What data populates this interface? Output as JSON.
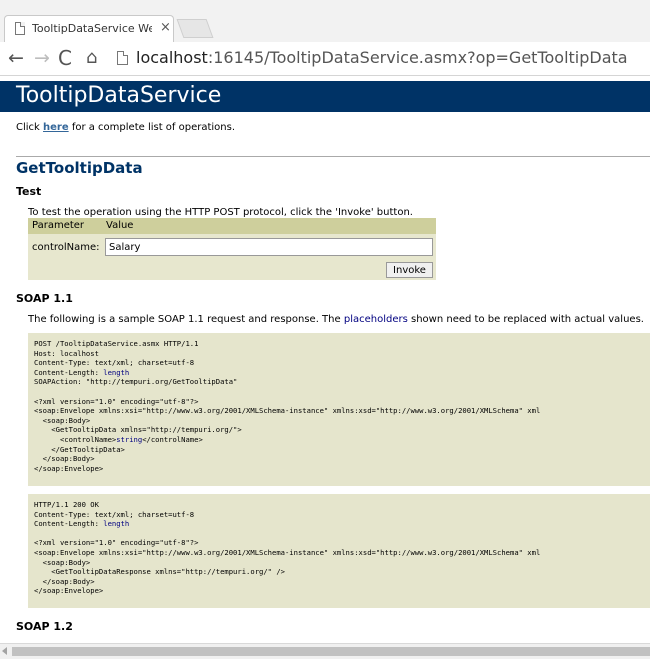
{
  "browser": {
    "tab_title": "TooltipDataService Web S",
    "close_glyph": "×",
    "url_host": "localhost",
    "url_rest": ":16145/TooltipDataService.asmx?op=GetTooltipData"
  },
  "page": {
    "header": "TooltipDataService",
    "intro_pre": "Click ",
    "intro_link": "here",
    "intro_post": " for a complete list of operations.",
    "operation": "GetTooltipData",
    "test_heading": "Test",
    "test_intro": "To test the operation using the HTTP POST protocol, click the 'Invoke' button.",
    "col_parameter": "Parameter",
    "col_value": "Value",
    "param_label": "controlName:",
    "param_value": "Salary",
    "invoke_label": "Invoke",
    "soap11_heading": "SOAP 1.1",
    "soap11_intro_pre": "The following is a sample SOAP 1.1 request and response.  The ",
    "soap11_intro_hl": "placeholders",
    "soap11_intro_post": " shown need to be replaced with actual values.",
    "soap12_heading": "SOAP 1.2"
  },
  "request": {
    "l1": "POST /TooltipDataService.asmx HTTP/1.1",
    "l2": "Host: localhost",
    "l3": "Content-Type: text/xml; charset=utf-8",
    "l4a": "Content-Length: ",
    "l4b": "length",
    "l5": "SOAPAction: \"http://tempuri.org/GetTooltipData\"",
    "l6": "<?xml version=\"1.0\" encoding=\"utf-8\"?>",
    "l7": "<soap:Envelope xmlns:xsi=\"http://www.w3.org/2001/XMLSchema-instance\" xmlns:xsd=\"http://www.w3.org/2001/XMLSchema\" xml",
    "l8": "  <soap:Body>",
    "l9": "    <GetTooltipData xmlns=\"http://tempuri.org/\">",
    "l10a": "      <controlName>",
    "l10b": "string",
    "l10c": "</controlName>",
    "l11": "    </GetTooltipData>",
    "l12": "  </soap:Body>",
    "l13": "</soap:Envelope>"
  },
  "response": {
    "l1": "HTTP/1.1 200 OK",
    "l2": "Content-Type: text/xml; charset=utf-8",
    "l3a": "Content-Length: ",
    "l3b": "length",
    "l4": "<?xml version=\"1.0\" encoding=\"utf-8\"?>",
    "l5": "<soap:Envelope xmlns:xsi=\"http://www.w3.org/2001/XMLSchema-instance\" xmlns:xsd=\"http://www.w3.org/2001/XMLSchema\" xml",
    "l6": "  <soap:Body>",
    "l7": "    <GetTooltipDataResponse xmlns=\"http://tempuri.org/\" />",
    "l8": "  </soap:Body>",
    "l9": "</soap:Envelope>"
  },
  "colors": {
    "header_bg": "#003366",
    "table_header_bg": "#cecf9c",
    "table_body_bg": "#e7e7ce",
    "code_bg": "#e5e5cc",
    "link": "#336699"
  },
  "icons": {
    "back": "←",
    "forward": "→",
    "reload": "C",
    "home": "⌂"
  }
}
